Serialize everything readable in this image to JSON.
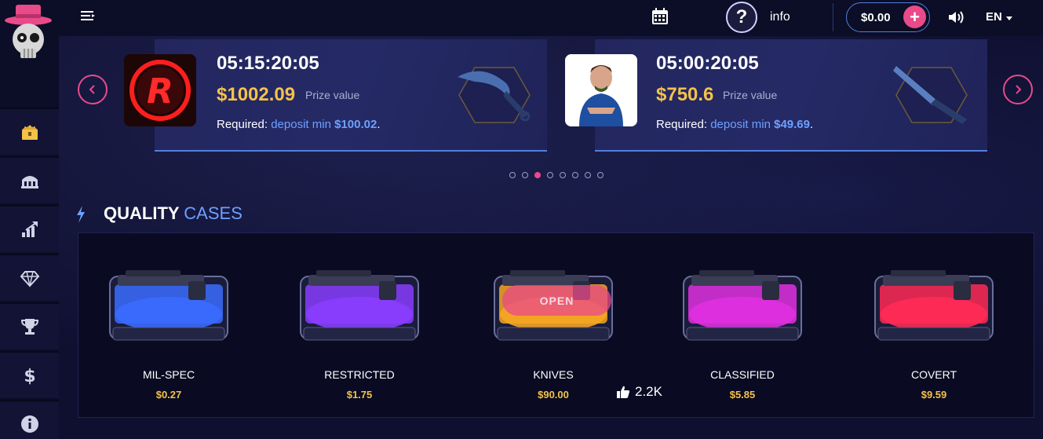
{
  "topbar": {
    "info_label": "info",
    "balance": "$0.00",
    "plus_label": "+",
    "language": "EN",
    "help_label": "?"
  },
  "giveaways": [
    {
      "timer": "05:15:20:05",
      "prize": "$1002.09",
      "prize_label": "Prize value",
      "required_prefix": "Required:",
      "required_link": "deposit min",
      "required_amount": "$100.02",
      "required_suffix": "."
    },
    {
      "timer": "05:00:20:05",
      "prize": "$750.6",
      "prize_label": "Prize value",
      "required_prefix": "Required:",
      "required_link": "deposit min",
      "required_amount": "$49.69",
      "required_suffix": "."
    }
  ],
  "carousel": {
    "dot_count": 8,
    "active_dot": 2
  },
  "section": {
    "title_main": "QUALITY",
    "title_accent": "CASES"
  },
  "cases": [
    {
      "name": "MIL-SPEC",
      "price": "$0.27",
      "color": "#3a6cff"
    },
    {
      "name": "RESTRICTED",
      "price": "$1.75",
      "color": "#8a3dff"
    },
    {
      "name": "KNIVES",
      "price": "$90.00",
      "color": "#f5a623"
    },
    {
      "name": "CLASSIFIED",
      "price": "$5.85",
      "color": "#e030e0"
    },
    {
      "name": "COVERT",
      "price": "$9.59",
      "color": "#ff2a55"
    }
  ],
  "open_label": "OPEN",
  "likes": "2.2K",
  "colors": {
    "accent_pink": "#e94a8a",
    "accent_blue": "#6ea0ff",
    "gold": "#f5c24a"
  }
}
